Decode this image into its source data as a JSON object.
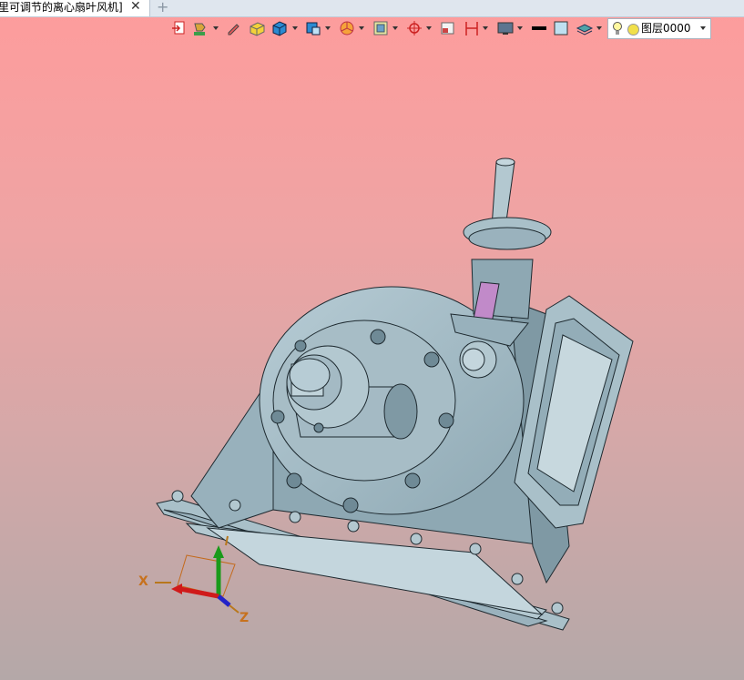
{
  "tab": {
    "title": "里可调节的离心扇叶风机]",
    "close_glyph": "✕",
    "new_glyph": "+"
  },
  "toolbar": {
    "icons": [
      "import-icon",
      "paint-icon",
      "pencil-icon",
      "solid-box-icon",
      "cube-icon",
      "view-cube-icon",
      "pie-section-icon",
      "frame-icon",
      "target-icon",
      "panel-icon",
      "measure-icon",
      "monitor-icon",
      "line-black-icon",
      "square-icon",
      "layer-stack-icon"
    ],
    "layer": {
      "name": "图层0000"
    }
  },
  "axes": {
    "x": "X",
    "z": "Z"
  },
  "colors": {
    "model": "#9fb8c3",
    "model_dark": "#6f8a96",
    "edge": "#1e2a30",
    "bg_top": "#fe9c9c",
    "bg_bottom": "#b4a8a8"
  }
}
